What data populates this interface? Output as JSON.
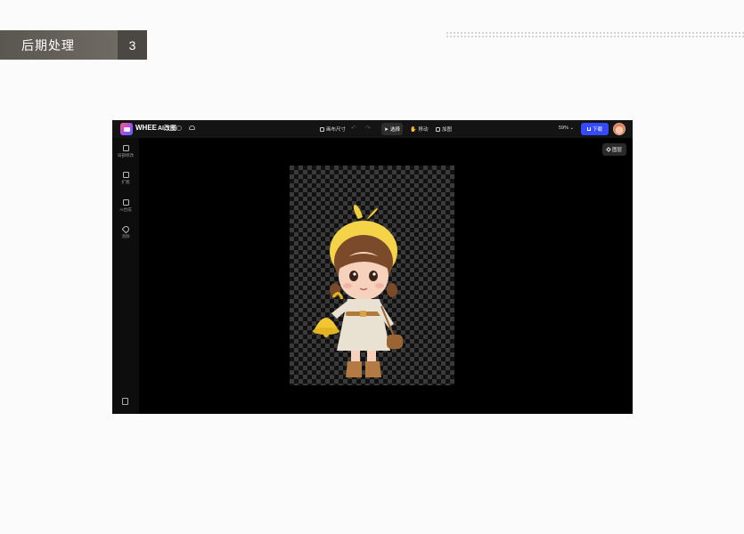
{
  "slide": {
    "title": "后期处理",
    "page_number": "3"
  },
  "app": {
    "brand": "WHEE",
    "product": "AI改图",
    "toolbar": {
      "canvas_size": "画布尺寸",
      "select": "选择",
      "move": "移动",
      "add_image": "加图",
      "zoom": "59%",
      "download": "下载"
    },
    "sidebar": [
      {
        "label": "局部修改",
        "icon": "edit-icon"
      },
      {
        "label": "扩图",
        "icon": "expand-icon"
      },
      {
        "label": "AI合成",
        "icon": "compose-icon"
      },
      {
        "label": "消除",
        "icon": "eraser-icon"
      }
    ],
    "layers_button": "图层"
  },
  "colors": {
    "accent": "#3549ff",
    "slide_header": "#5a5650"
  }
}
